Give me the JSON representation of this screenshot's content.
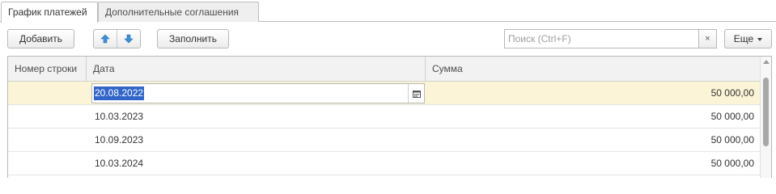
{
  "tabs": [
    {
      "label": "График платежей",
      "active": true
    },
    {
      "label": "Дополнительные соглашения",
      "active": false
    }
  ],
  "toolbar": {
    "add_label": "Добавить",
    "move_up_icon": "arrow-up-icon",
    "move_down_icon": "arrow-down-icon",
    "fill_label": "Заполнить",
    "more_label": "Еще",
    "clear_symbol": "×"
  },
  "search": {
    "placeholder": "Поиск (Ctrl+F)",
    "value": ""
  },
  "table": {
    "columns": [
      "Номер строки",
      "Дата",
      "Сумма"
    ],
    "rows": [
      {
        "number": "",
        "date": "20.08.2022",
        "amount": "50 000,00",
        "selected": true,
        "editing": true
      },
      {
        "number": "",
        "date": "10.03.2023",
        "amount": "50 000,00"
      },
      {
        "number": "",
        "date": "10.09.2023",
        "amount": "50 000,00"
      },
      {
        "number": "",
        "date": "10.03.2024",
        "amount": "50 000,00"
      }
    ]
  },
  "colors": {
    "accent_arrow": "#3d8fd8",
    "selected_row": "#fcf4d6",
    "text_selection": "#3165c8"
  }
}
